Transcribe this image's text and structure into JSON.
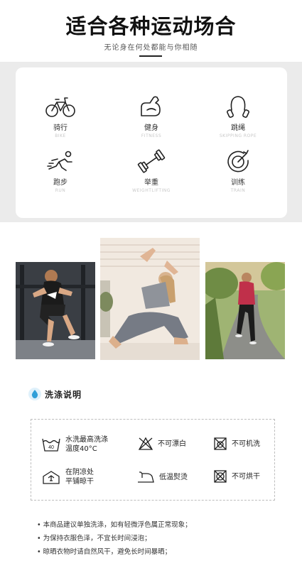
{
  "header": {
    "title": "适合各种运动场合",
    "subtitle": "无论身在何处都能与你相随"
  },
  "activities": [
    {
      "icon": "bicycle-icon",
      "cn": "骑行",
      "en": "BIKE"
    },
    {
      "icon": "flexed-arm-icon",
      "cn": "健身",
      "en": "FITNESS"
    },
    {
      "icon": "jump-rope-icon",
      "cn": "跳绳",
      "en": "SKIPPING ROPE"
    },
    {
      "icon": "running-icon",
      "cn": "跑步",
      "en": "RUN"
    },
    {
      "icon": "dumbbell-icon",
      "cn": "举重",
      "en": "WEIGHTLIFTING"
    },
    {
      "icon": "target-icon",
      "cn": "训练",
      "en": "TRAIN"
    }
  ],
  "care": {
    "title": "洗涤说明",
    "items": [
      {
        "icon": "wash-40-icon",
        "label_line1": "水洗最高洗涤",
        "label_line2": "温度40°C"
      },
      {
        "icon": "no-bleach-icon",
        "label_line1": "不可漂白",
        "label_line2": ""
      },
      {
        "icon": "no-machine-wash-icon",
        "label_line1": "不可机洗",
        "label_line2": ""
      },
      {
        "icon": "line-dry-shade-icon",
        "label_line1": "在阴凉处",
        "label_line2": "平铺晾干"
      },
      {
        "icon": "low-iron-icon",
        "label_line1": "低温熨烫",
        "label_line2": ""
      },
      {
        "icon": "no-tumble-dry-icon",
        "label_line1": "不可烘干",
        "label_line2": ""
      }
    ]
  },
  "notes": [
    "• 本商品建议单独洗涤，如有轻微浮色属正常现象；",
    "• 为保持衣服色泽，不宜长时间浸泡；",
    "• 晾晒衣物时请自然风干，避免长时间暴晒；"
  ]
}
